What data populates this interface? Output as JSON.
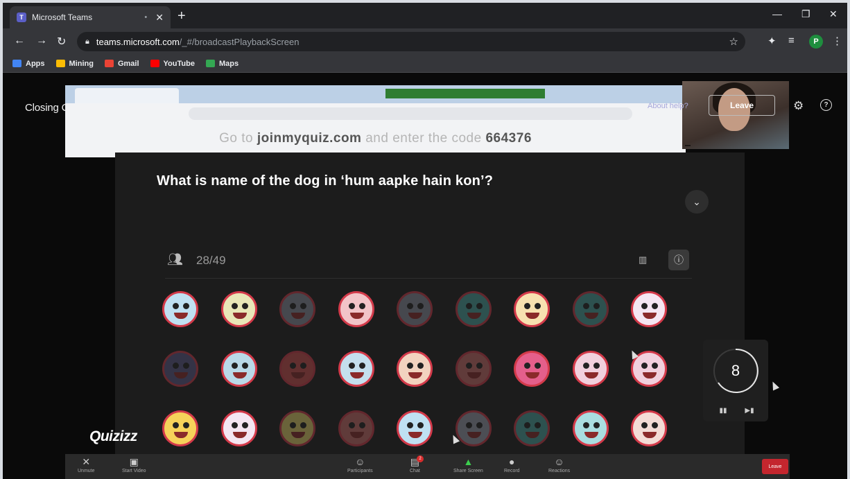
{
  "browser": {
    "tab_title": "Microsoft Teams",
    "url_host": "teams.microsoft.com",
    "url_path": "/_#/broadcastPlaybackScreen",
    "profile_initial": "P",
    "bookmarks": [
      {
        "label": "Apps",
        "color": "#4285f4"
      },
      {
        "label": "Mining",
        "color": "#fbbc04"
      },
      {
        "label": "Gmail",
        "color": "#ea4335"
      },
      {
        "label": "YouTube",
        "color": "#ff0000"
      },
      {
        "label": "Maps",
        "color": "#34a853"
      }
    ]
  },
  "meeting": {
    "title": "Closing Ceremony",
    "about_link": "About help?",
    "leave_label": "Leave"
  },
  "presentation": {
    "join_prefix": "Go to",
    "join_site": "joinmyquiz.com",
    "join_middle": "and enter the code",
    "join_code": "664376",
    "question": "What is name of the dog in ‘hum aapke hain kon’?",
    "response_count": "28/49",
    "timer_value": "8",
    "logo": "Quizizz"
  },
  "avatars": [
    {
      "color": "#bfe0f2",
      "dim": false
    },
    {
      "color": "#e8e7b8",
      "dim": false
    },
    {
      "color": "#8a8fa0",
      "dim": true
    },
    {
      "color": "#f2c4c8",
      "dim": false
    },
    {
      "color": "#8a8fa0",
      "dim": true
    },
    {
      "color": "#4aa7a3",
      "dim": true
    },
    {
      "color": "#f7e1b0",
      "dim": false
    },
    {
      "color": "#4aa7a3",
      "dim": true
    },
    {
      "color": "#f4e6f2",
      "dim": false
    },
    {
      "color": "#5b5a8c",
      "dim": true
    },
    {
      "color": "#b9d9e8",
      "dim": false
    },
    {
      "color": "#d2504f",
      "dim": true
    },
    {
      "color": "#c4dfee",
      "dim": false
    },
    {
      "color": "#f2d3bf",
      "dim": false
    },
    {
      "color": "#d06e6c",
      "dim": true
    },
    {
      "color": "#e45f8b",
      "dim": false
    },
    {
      "color": "#f1d0dd",
      "dim": false
    },
    {
      "color": "#f1d0dd",
      "dim": false
    },
    {
      "color": "#f6d25a",
      "dim": false
    },
    {
      "color": "#f4e6f2",
      "dim": false
    },
    {
      "color": "#e9d66b",
      "dim": true
    },
    {
      "color": "#d06e6c",
      "dim": true
    },
    {
      "color": "#bfe0f2",
      "dim": false
    },
    {
      "color": "#9aa0b0",
      "dim": true
    },
    {
      "color": "#4aa7a3",
      "dim": true
    },
    {
      "color": "#a9dde0",
      "dim": false
    },
    {
      "color": "#f3dcd6",
      "dim": false
    }
  ],
  "controls": [
    {
      "label": "Unmute",
      "icon": "microphone-off-icon",
      "glyph": "✕"
    },
    {
      "label": "Start Video",
      "icon": "camera-off-icon",
      "glyph": "▣"
    },
    {
      "label": "Participants",
      "icon": "participants-icon",
      "glyph": "☺"
    },
    {
      "label": "Chat",
      "icon": "chat-icon",
      "glyph": "▤"
    },
    {
      "label": "Share Screen",
      "icon": "share-screen-icon",
      "glyph": "▲"
    },
    {
      "label": "Record",
      "icon": "record-icon",
      "glyph": "●"
    },
    {
      "label": "Reactions",
      "icon": "reactions-icon",
      "glyph": "☺"
    }
  ],
  "controls_leave": "Leave",
  "chat_badge": "2"
}
